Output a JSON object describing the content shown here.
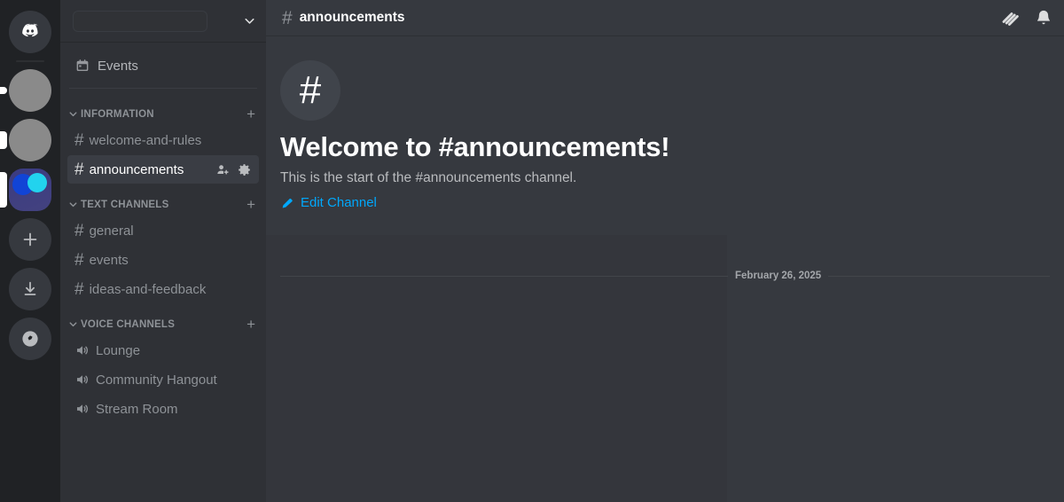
{
  "rail": {
    "items": [
      {
        "name": "home-discord",
        "type": "home",
        "indicator": "none",
        "label": "Discord"
      },
      {
        "name": "server-1",
        "type": "gray",
        "indicator": "dot",
        "label": ""
      },
      {
        "name": "server-2",
        "type": "gray",
        "indicator": "small",
        "label": ""
      },
      {
        "name": "server-active",
        "type": "squircle",
        "indicator": "active",
        "label": ""
      }
    ],
    "actions": [
      {
        "name": "add-server",
        "icon": "plus-icon",
        "label": "Add a Server"
      },
      {
        "name": "download-apps",
        "icon": "download-icon",
        "label": "Download Apps"
      },
      {
        "name": "explore-servers",
        "icon": "compass-icon",
        "label": "Explore Discoverable Servers"
      }
    ]
  },
  "sidebar": {
    "server_name": "",
    "chevron": "chevron-down-icon",
    "events_label": "Events",
    "categories": [
      {
        "name": "INFORMATION",
        "add_label": "+",
        "channels": [
          {
            "label": "welcome-and-rules",
            "type": "text",
            "active": false
          },
          {
            "label": "announcements",
            "type": "text",
            "active": true
          }
        ]
      },
      {
        "name": "TEXT CHANNELS",
        "add_label": "+",
        "channels": [
          {
            "label": "general",
            "type": "text",
            "active": false
          },
          {
            "label": "events",
            "type": "text",
            "active": false
          },
          {
            "label": "ideas-and-feedback",
            "type": "text",
            "active": false
          }
        ]
      },
      {
        "name": "VOICE CHANNELS",
        "add_label": "+",
        "channels": [
          {
            "label": "Lounge",
            "type": "voice",
            "active": false
          },
          {
            "label": "Community Hangout",
            "type": "voice",
            "active": false
          },
          {
            "label": "Stream Room",
            "type": "voice",
            "active": false
          }
        ]
      }
    ],
    "active_channel_actions": [
      {
        "name": "create-invite-icon",
        "label": "Create Invite"
      },
      {
        "name": "edit-channel-icon",
        "label": "Edit Channel"
      }
    ]
  },
  "header": {
    "channel_name": "announcements",
    "hash": "#",
    "actions": [
      {
        "name": "threads-icon",
        "label": "Threads"
      },
      {
        "name": "notification-bell-icon",
        "label": "Notification Settings"
      }
    ]
  },
  "main": {
    "hash_glyph": "#",
    "welcome_title": "Welcome to #announcements!",
    "welcome_subtitle": "This is the start of the #announcements channel.",
    "edit_channel_label": "Edit Channel",
    "date_divider": "February 26, 2025"
  },
  "colors": {
    "rail_bg": "#202225",
    "sidebar_bg": "#2f3136",
    "main_bg": "#36393f",
    "active_channel_bg": "#3a3d44",
    "link_blue": "#00a8fc",
    "text_muted": "#8e9297",
    "text_primary": "#ffffff"
  }
}
